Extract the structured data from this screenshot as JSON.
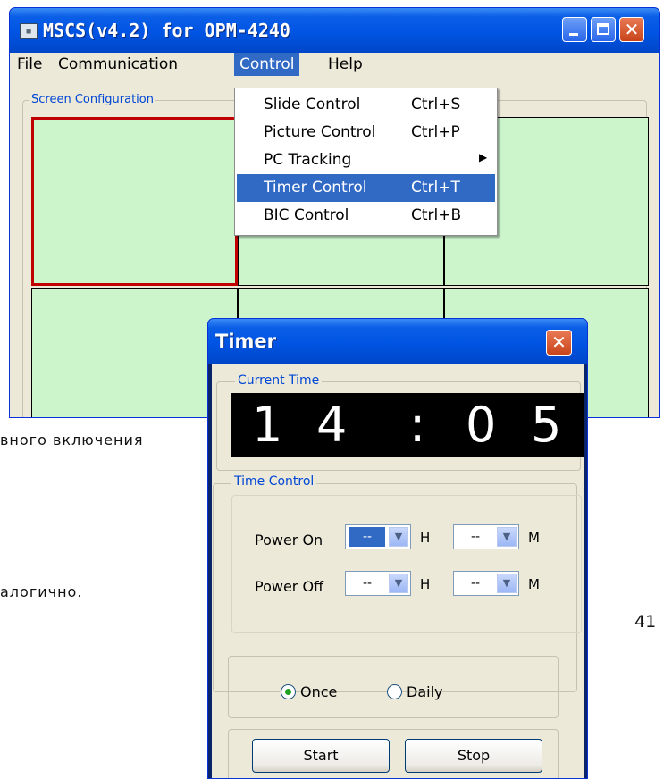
{
  "main_window": {
    "title": "MSCS(v4.2) for OPM-4240",
    "menu": [
      "File",
      "Communication",
      "Control",
      "Help"
    ],
    "group_label": "Screen Configuration",
    "control_menu": [
      {
        "label": "Slide Control",
        "shortcut": "Ctrl+S"
      },
      {
        "label": "Picture Control",
        "shortcut": "Ctrl+P"
      },
      {
        "label": "PC Tracking",
        "shortcut": "",
        "submenu": true
      },
      {
        "label": "Timer Control",
        "shortcut": "Ctrl+T",
        "highlighted": true
      },
      {
        "label": "BIC Control",
        "shortcut": "Ctrl+B"
      }
    ]
  },
  "document": {
    "line_1": "вного включения",
    "line_2": "алогично.",
    "page_number": "41"
  },
  "timer_dialog": {
    "title": "Timer",
    "current_time_label": "Current Time",
    "clock": {
      "h1": "1",
      "h2": "4",
      "sep": ":",
      "m1": "0",
      "m2": "5"
    },
    "time_control_label": "Time Control",
    "power_on_label": "Power On",
    "power_off_label": "Power Off",
    "power_on_hour": "--",
    "power_on_minute": "--",
    "power_off_hour": "--",
    "power_off_minute": "--",
    "hour_unit": "H",
    "minute_unit": "M",
    "once_label": "Once",
    "daily_label": "Daily",
    "start_label": "Start",
    "stop_label": "Stop"
  },
  "colors": {
    "titlebar": "#0054e3",
    "cell_fill": "#ccf5cc",
    "selected_cell_border": "#c00000",
    "menu_highlight": "#316ac5",
    "group_label": "#0046d5"
  }
}
